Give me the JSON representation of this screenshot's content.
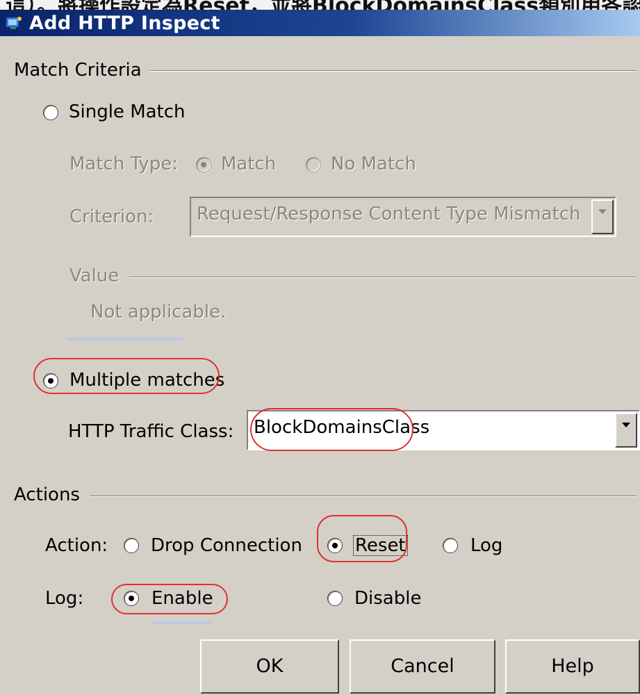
{
  "caption": "這）。將操作設定為Reset，並將BlockDomainsClass類別用各認",
  "window": {
    "title": "Add HTTP Inspect"
  },
  "match_criteria": {
    "heading": "Match Criteria",
    "single_match_label": "Single Match",
    "match_type": {
      "label": "Match Type:",
      "match_label": "Match",
      "no_match_label": "No Match"
    },
    "criterion": {
      "label": "Criterion:",
      "value": "Request/Response Content Type Mismatch"
    },
    "value_group": {
      "heading": "Value",
      "text": "Not applicable."
    },
    "multiple_matches_label": "Multiple matches",
    "traffic_class": {
      "label": "HTTP Traffic Class:",
      "value": "BlockDomainsClass"
    }
  },
  "actions": {
    "heading": "Actions",
    "action_label": "Action:",
    "drop_label": "Drop Connection",
    "reset_label": "Reset",
    "log_option_label": "Log",
    "log_label": "Log:",
    "enable_label": "Enable",
    "disable_label": "Disable"
  },
  "buttons": {
    "ok": "OK",
    "cancel": "Cancel",
    "help": "Help"
  },
  "colors": {
    "annotation": "#e03030",
    "titlebar": "#0a246a",
    "dialog_bg": "#d4d0c8"
  }
}
